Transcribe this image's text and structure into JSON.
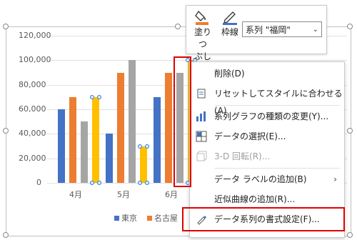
{
  "colors": {
    "tokyo": "#4472c4",
    "nagoya": "#ed7d31",
    "osaka": "#a5a5a5",
    "fukuoka": "#ffc000",
    "highlight": "#e00000",
    "selection": "#2f7bd6"
  },
  "chart_data": {
    "type": "bar",
    "categories": [
      "4月",
      "5月",
      "6月"
    ],
    "ylim": [
      0,
      120000
    ],
    "y_ticks": [
      "0",
      "20,000",
      "40,000",
      "60,000",
      "80,000",
      "100,000",
      "120,000"
    ],
    "series": [
      {
        "name": "東京",
        "values": [
          60000,
          40000,
          70000
        ]
      },
      {
        "name": "名古屋",
        "values": [
          70000,
          90000,
          90000
        ]
      },
      {
        "name": "",
        "values": [
          50000,
          100000,
          90000
        ]
      },
      {
        "name": "",
        "values": [
          70000,
          30000,
          100000
        ]
      }
    ],
    "gridlines": true,
    "legend_position": "bottom"
  },
  "mini_toolbar": {
    "fill_label_line1": "塗りつ",
    "fill_label_line2": "ぶし",
    "outline_label": "枠線",
    "series_select_value": "系列 \"福岡\""
  },
  "context_menu": {
    "items": [
      {
        "label": "削除(D)",
        "icon": "trash-icon",
        "enabled": true
      },
      {
        "label": "リセットしてスタイルに合わせる(A)",
        "icon": "reset-style-icon",
        "enabled": true
      },
      {
        "label": "系列グラフの種類の変更(Y)...",
        "icon": "chart-type-icon",
        "enabled": true
      },
      {
        "label": "データの選択(E)...",
        "icon": "data-select-icon",
        "enabled": true
      },
      {
        "label": "3-D 回転(R)...",
        "icon": "rotate-3d-icon",
        "enabled": false
      },
      {
        "label": "データ ラベルの追加(B)",
        "icon": "",
        "enabled": true,
        "submenu": true
      },
      {
        "label": "近似曲線の追加(R)...",
        "icon": "",
        "enabled": true
      },
      {
        "label": "データ系列の書式設定(F)...",
        "icon": "format-series-icon",
        "enabled": true
      }
    ]
  }
}
